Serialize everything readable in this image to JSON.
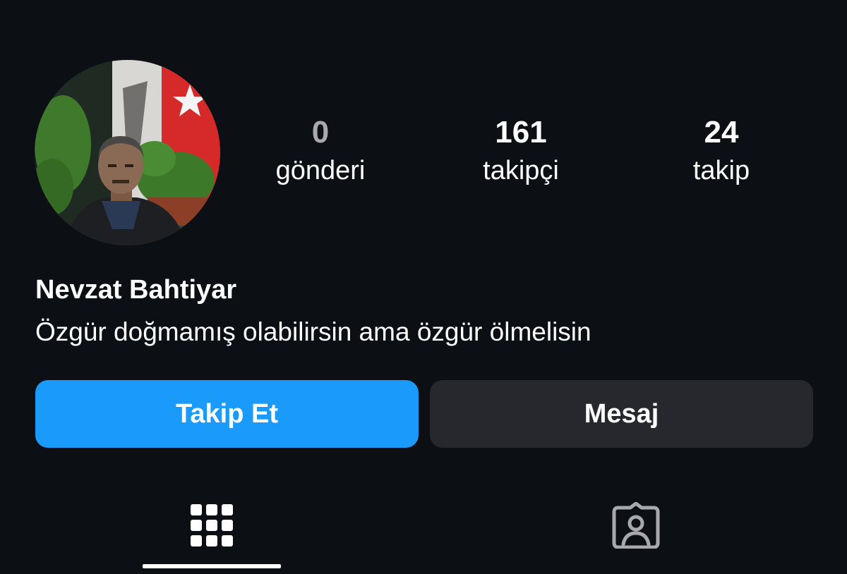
{
  "profile": {
    "name": "Nevzat Bahtiyar",
    "bio": "Özgür doğmamış olabilirsin ama özgür ölmelisin",
    "avatar_icon": "profile-photo"
  },
  "stats": {
    "posts": {
      "value": "0",
      "label": "gönderi"
    },
    "followers": {
      "value": "161",
      "label": "takipçi"
    },
    "following": {
      "value": "24",
      "label": "takip"
    }
  },
  "actions": {
    "follow_label": "Takip Et",
    "message_label": "Mesaj"
  },
  "tabs": {
    "grid_icon": "grid-icon",
    "tagged_icon": "tagged-icon",
    "active": "grid"
  },
  "colors": {
    "background": "#0c0f14",
    "follow_button": "#1a9bfb",
    "message_button": "#26282e",
    "muted_text": "#a8a8ad"
  }
}
